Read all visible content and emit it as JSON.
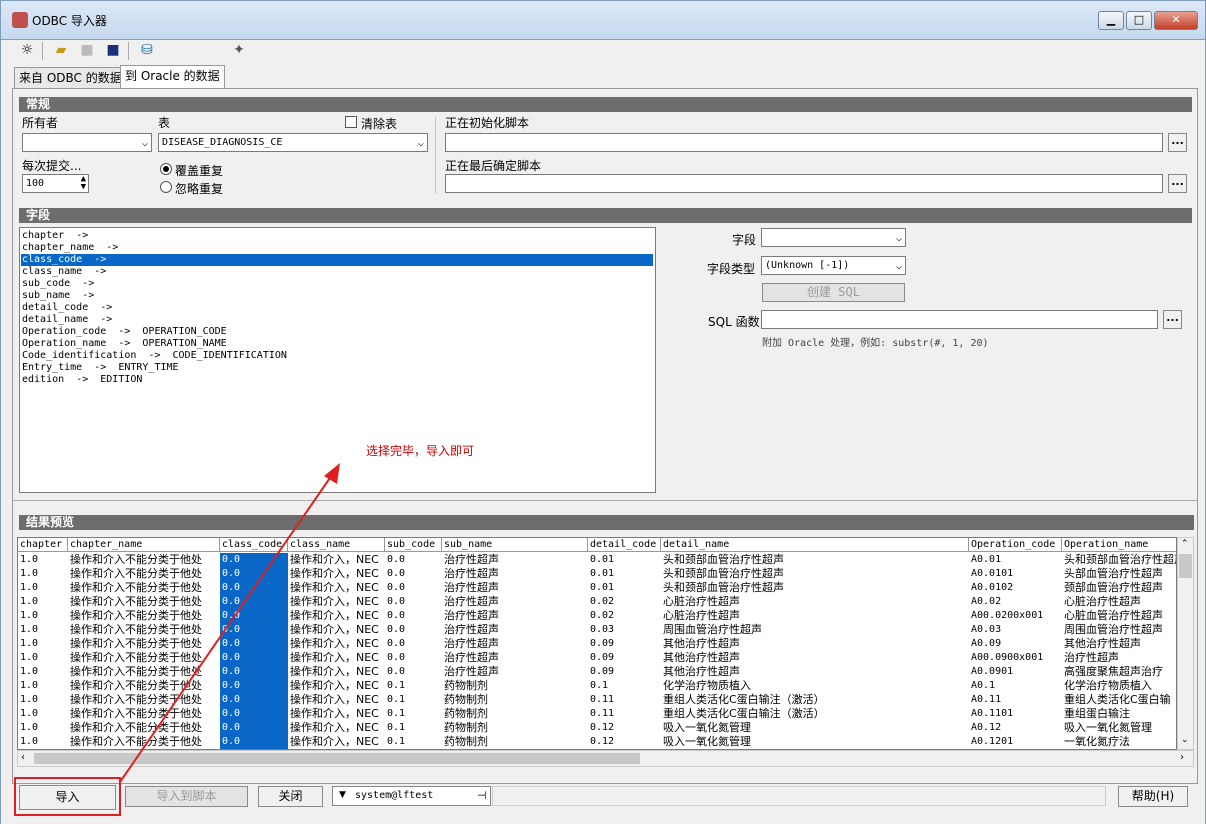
{
  "window": {
    "title": "ODBC 导入器",
    "minimize": "▁",
    "maximize": "□",
    "close": "✕"
  },
  "toolbar": {
    "icons": [
      "new-icon",
      "open-folder-icon",
      "save-disabled-icon",
      "save-icon",
      "database-icon",
      "magic-wand-icon"
    ]
  },
  "tabs": [
    {
      "label": "来自 ODBC 的数据",
      "active": false
    },
    {
      "label": "到 Oracle 的数据",
      "active": true
    }
  ],
  "general": {
    "header": "常规",
    "owner_label": "所有者",
    "owner_value": "",
    "table_label": "表",
    "table_value": "DISEASE_DIAGNOSIS_CE",
    "clear_table_label": "清除表",
    "clear_table_checked": false,
    "init_script_label": "正在初始化脚本",
    "init_script_value": "",
    "final_script_label": "正在最后确定脚本",
    "final_script_value": "",
    "commit_label": "每次提交...",
    "commit_value": "100",
    "overwrite_label": "覆盖重复",
    "ignore_label": "忽略重复",
    "dots": "..."
  },
  "fields": {
    "header": "字段",
    "items": [
      "chapter  ->",
      "chapter_name  ->",
      "class_code  ->",
      "class_name  ->",
      "sub_code  ->",
      "sub_name  ->",
      "detail_code  ->",
      "detail_name  ->",
      "Operation_code  ->  OPERATION_CODE",
      "Operation_name  ->  OPERATION_NAME",
      "Code_identification  ->  CODE_IDENTIFICATION",
      "Entry_time  ->  ENTRY_TIME",
      "edition  ->  EDITION"
    ],
    "selected_index": 2,
    "field_label": "字段",
    "field_value": "",
    "type_label": "字段类型",
    "type_value": "(Unknown [-1])",
    "create_sql": "创建 SQL",
    "sql_func_label": "SQL 函数",
    "sql_func_value": "",
    "hint": "附加 Oracle 处理，例如:  substr(#, 1, 20)"
  },
  "annotation": "选择完毕，导入即可",
  "preview": {
    "header": "结果预览",
    "columns": [
      "chapter",
      "chapter_name",
      "class_code",
      "class_name",
      "sub_code",
      "sub_name",
      "detail_code",
      "detail_name",
      "Operation_code",
      "Operation_name"
    ],
    "rows": [
      [
        "1.0",
        "操作和介入不能分类于他处",
        "0.0",
        "操作和介入，NEC",
        "0.0",
        "治疗性超声",
        "0.01",
        "头和颈部血管治疗性超声",
        "A0.01",
        "头和颈部血管治疗性超声"
      ],
      [
        "1.0",
        "操作和介入不能分类于他处",
        "0.0",
        "操作和介入，NEC",
        "0.0",
        "治疗性超声",
        "0.01",
        "头和颈部血管治疗性超声",
        "A0.0101",
        "头部血管治疗性超声"
      ],
      [
        "1.0",
        "操作和介入不能分类于他处",
        "0.0",
        "操作和介入，NEC",
        "0.0",
        "治疗性超声",
        "0.01",
        "头和颈部血管治疗性超声",
        "A0.0102",
        "颈部血管治疗性超声"
      ],
      [
        "1.0",
        "操作和介入不能分类于他处",
        "0.0",
        "操作和介入，NEC",
        "0.0",
        "治疗性超声",
        "0.02",
        "心脏治疗性超声",
        "A0.02",
        "心脏治疗性超声"
      ],
      [
        "1.0",
        "操作和介入不能分类于他处",
        "0.0",
        "操作和介入，NEC",
        "0.0",
        "治疗性超声",
        "0.02",
        "心脏治疗性超声",
        "A00.0200x001",
        "心脏血管治疗性超声"
      ],
      [
        "1.0",
        "操作和介入不能分类于他处",
        "0.0",
        "操作和介入，NEC",
        "0.0",
        "治疗性超声",
        "0.03",
        "周围血管治疗性超声",
        "A0.03",
        "周围血管治疗性超声"
      ],
      [
        "1.0",
        "操作和介入不能分类于他处",
        "0.0",
        "操作和介入，NEC",
        "0.0",
        "治疗性超声",
        "0.09",
        "其他治疗性超声",
        "A0.09",
        "其他治疗性超声"
      ],
      [
        "1.0",
        "操作和介入不能分类于他处",
        "0.0",
        "操作和介入，NEC",
        "0.0",
        "治疗性超声",
        "0.09",
        "其他治疗性超声",
        "A00.0900x001",
        "治疗性超声"
      ],
      [
        "1.0",
        "操作和介入不能分类于他处",
        "0.0",
        "操作和介入，NEC",
        "0.0",
        "治疗性超声",
        "0.09",
        "其他治疗性超声",
        "A0.0901",
        "高强度聚焦超声治疗"
      ],
      [
        "1.0",
        "操作和介入不能分类于他处",
        "0.0",
        "操作和介入，NEC",
        "0.1",
        "药物制剂",
        "0.1",
        "化学治疗物质植入",
        "A0.1",
        "化学治疗物质植入"
      ],
      [
        "1.0",
        "操作和介入不能分类于他处",
        "0.0",
        "操作和介入，NEC",
        "0.1",
        "药物制剂",
        "0.11",
        "重组人类活化C蛋白输注（激活）",
        "A0.11",
        "重组人类活化C蛋白输"
      ],
      [
        "1.0",
        "操作和介入不能分类于他处",
        "0.0",
        "操作和介入，NEC",
        "0.1",
        "药物制剂",
        "0.11",
        "重组人类活化C蛋白输注（激活）",
        "A0.1101",
        "重组蛋白输注"
      ],
      [
        "1.0",
        "操作和介入不能分类于他处",
        "0.0",
        "操作和介入，NEC",
        "0.1",
        "药物制剂",
        "0.12",
        "吸入一氧化氮管理",
        "A0.12",
        "吸入一氧化氮管理"
      ],
      [
        "1.0",
        "操作和介入不能分类于他处",
        "0.0",
        "操作和介入，NEC",
        "0.1",
        "药物制剂",
        "0.12",
        "吸入一氧化氮管理",
        "A0.1201",
        "一氧化氮疗法"
      ]
    ]
  },
  "bottom": {
    "import": "导入",
    "import_to_script": "导入到脚本",
    "close": "关闭",
    "connection": "system@lftest",
    "help": "帮助(H)"
  }
}
